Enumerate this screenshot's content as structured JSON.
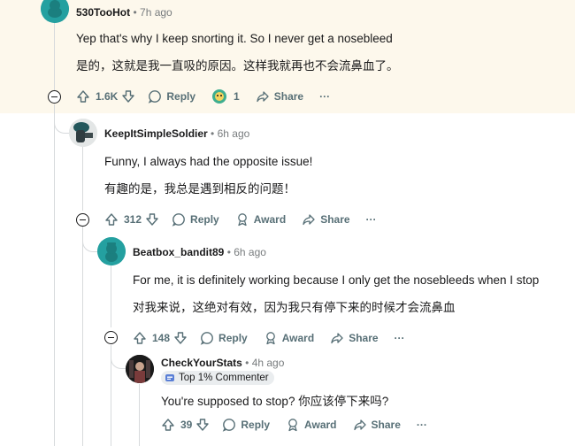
{
  "comments": [
    {
      "username": "530TooHot",
      "time": "7h ago",
      "text_en": "Yep that's why I keep snorting it. So I never get a nosebleed",
      "text_zh": "是的，这就是我一直吸的原因。这样我就再也不会流鼻血了。",
      "votes": "1.6K",
      "reply_label": "Reply",
      "award_count": "1",
      "share_label": "Share",
      "more_label": "···"
    },
    {
      "username": "KeepItSimpleSoldier",
      "time": "6h ago",
      "text_en": "Funny, I always had the opposite issue!",
      "text_zh": "有趣的是，我总是遇到相反的问题！",
      "votes": "312",
      "reply_label": "Reply",
      "award_label": "Award",
      "share_label": "Share",
      "more_label": "···"
    },
    {
      "username": "Beatbox_bandit89",
      "time": "6h ago",
      "text_en": "For me, it is definitely working because I only get the nosebleeds when I stop",
      "text_zh": "对我来说，这绝对有效，因为我只有停下来的时候才会流鼻血",
      "votes": "148",
      "reply_label": "Reply",
      "award_label": "Award",
      "share_label": "Share",
      "more_label": "···"
    },
    {
      "username": "CheckYourStats",
      "time": "4h ago",
      "flair": "Top 1% Commenter",
      "text": "You're supposed to stop?  你应该停下来吗?",
      "votes": "39",
      "reply_label": "Reply",
      "award_label": "Award",
      "share_label": "Share",
      "more_label": "···"
    }
  ],
  "separator": "•",
  "colors": {
    "highlight": "#fdf8ec",
    "snoo_teal": "#24a0a0",
    "meta_gray": "#787c7e"
  }
}
